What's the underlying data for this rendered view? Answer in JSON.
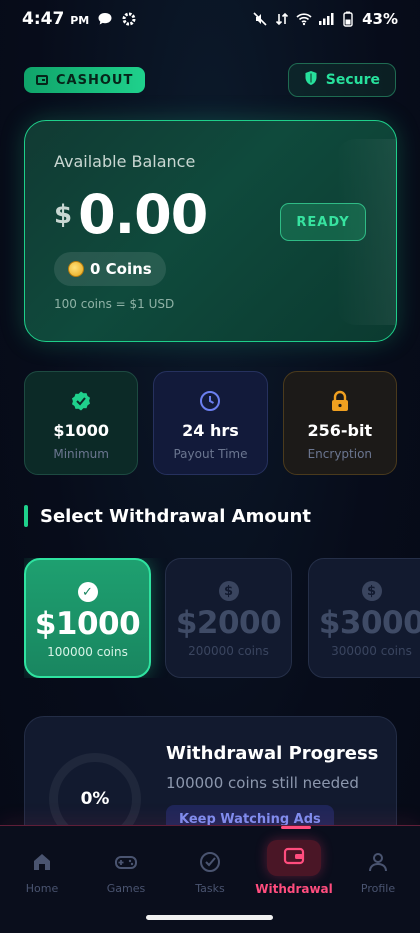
{
  "status_bar": {
    "time": "4:47",
    "ampm": "PM",
    "battery": "43%"
  },
  "header": {
    "badge_label": "CASHOUT",
    "secure_label": "Secure"
  },
  "balance": {
    "label": "Available Balance",
    "currency": "$",
    "amount": "0.00",
    "status": "READY",
    "coins": "0 Coins",
    "rate": "100 coins = $1 USD"
  },
  "stats": [
    {
      "value": "$1000",
      "label": "Minimum",
      "icon": "verified-check-icon"
    },
    {
      "value": "24 hrs",
      "label": "Payout Time",
      "icon": "clock-icon"
    },
    {
      "value": "256-bit",
      "label": "Encryption",
      "icon": "lock-icon"
    }
  ],
  "section": {
    "title": "Select Withdrawal Amount"
  },
  "amounts": [
    {
      "value": "$1000",
      "coins": "100000 coins",
      "selected": true
    },
    {
      "value": "$2000",
      "coins": "200000 coins",
      "selected": false
    },
    {
      "value": "$3000",
      "coins": "300000 coins",
      "selected": false
    }
  ],
  "progress": {
    "percent": "0%",
    "fraction": 0,
    "title": "Withdrawal Progress",
    "subtitle": "100000 coins still needed",
    "button": "Keep Watching Ads"
  },
  "nav": {
    "items": [
      {
        "label": "Home",
        "icon": "home-icon"
      },
      {
        "label": "Games",
        "icon": "gamepad-icon"
      },
      {
        "label": "Tasks",
        "icon": "task-check-icon"
      },
      {
        "label": "Withdrawal",
        "icon": "wallet-icon",
        "active": true
      },
      {
        "label": "Profile",
        "icon": "profile-icon"
      }
    ]
  },
  "colors": {
    "accent_green": "#1fd18c",
    "accent_pink": "#ff4d7e",
    "background": "#070c1a"
  }
}
